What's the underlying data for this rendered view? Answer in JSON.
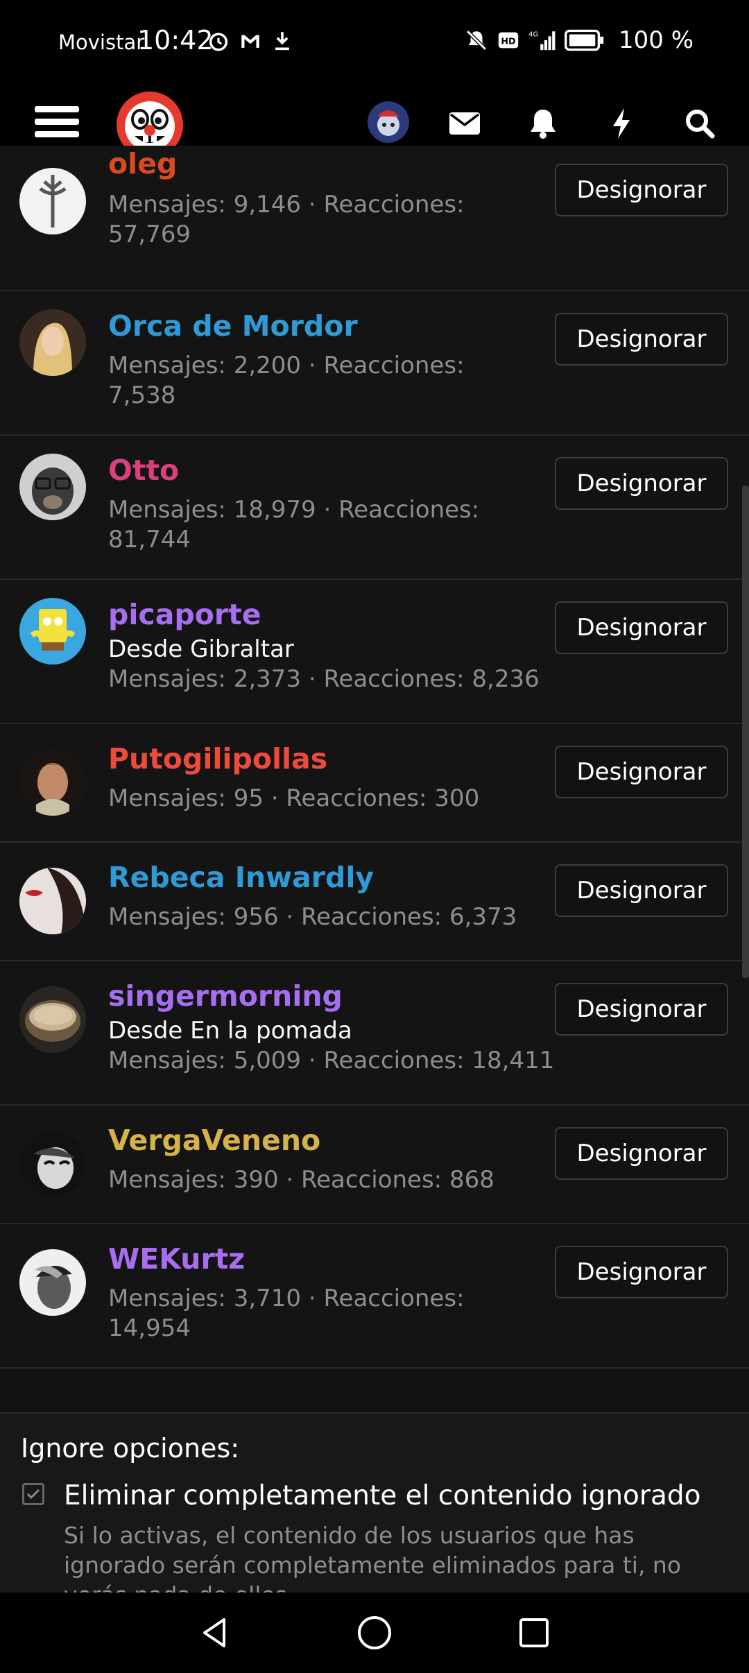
{
  "status_bar": {
    "carrier": "Movistar",
    "time": "10:42",
    "battery": "100 %"
  },
  "header": {
    "icons": [
      "menu-icon",
      "logo",
      "user-avatar",
      "mail-icon",
      "bell-icon",
      "bolt-icon",
      "search-icon"
    ]
  },
  "users": [
    {
      "name": "oleg",
      "color": "#d84a1f",
      "location": "",
      "stats_line1": "Mensajes: 9,146 · Reacciones:",
      "stats_line2": "57,769",
      "button": "Designorar"
    },
    {
      "name": "Orca de Mordor",
      "color": "#2f9bd6",
      "location": "",
      "stats_line1": "Mensajes: 2,200 · Reacciones:",
      "stats_line2": "7,538",
      "button": "Designorar"
    },
    {
      "name": "Otto",
      "color": "#d8407e",
      "location": "",
      "stats_line1": "Mensajes: 18,979 · Reacciones:",
      "stats_line2": "81,744",
      "button": "Designorar"
    },
    {
      "name": "picaporte",
      "color": "#a86ef0",
      "location": "Desde Gibraltar",
      "stats_line1": "Mensajes: 2,373 · Reacciones: 8,236",
      "stats_line2": "",
      "button": "Designorar"
    },
    {
      "name": "Putogilipollas",
      "color": "#ef4a3a",
      "location": "",
      "stats_line1": "Mensajes: 95 · Reacciones: 300",
      "stats_line2": "",
      "button": "Designorar"
    },
    {
      "name": "Rebeca Inwardly",
      "color": "#2f9bd6",
      "location": "",
      "stats_line1": "Mensajes: 956 · Reacciones: 6,373",
      "stats_line2": "",
      "button": "Designorar"
    },
    {
      "name": "singermorning",
      "color": "#a86ef0",
      "location": "Desde En la pomada",
      "stats_line1": "Mensajes: 5,009 · Reacciones: 18,411",
      "stats_line2": "",
      "button": "Designorar"
    },
    {
      "name": "VergaVeneno",
      "color": "#d6b24a",
      "location": "",
      "stats_line1": "Mensajes: 390 · Reacciones: 868",
      "stats_line2": "",
      "button": "Designorar"
    },
    {
      "name": "WEKurtz",
      "color": "#a86ef0",
      "location": "",
      "stats_line1": "Mensajes: 3,710 · Reacciones:",
      "stats_line2": "14,954",
      "button": "Designorar"
    }
  ],
  "ignore_options": {
    "title": "Ignore opciones:",
    "checkbox_label": "Eliminar completamente el contenido ignorado",
    "description": "Si lo activas, el contenido de los usuarios que has ignorado serán completamente eliminados para ti, no verás nada de ellos."
  }
}
